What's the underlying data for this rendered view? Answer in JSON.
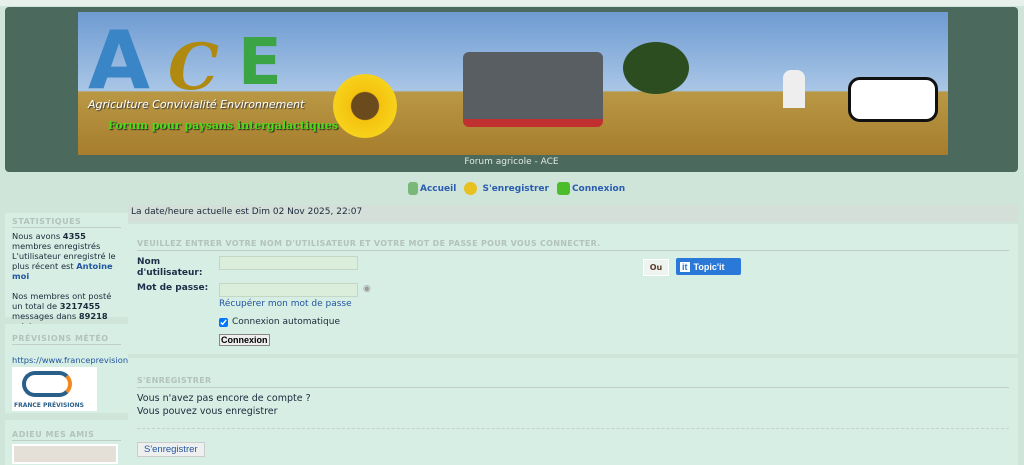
{
  "header": {
    "logo_letters": "ACE",
    "logo_tagline": "Agriculture  Convivialité  Environnement",
    "logo_subtitle": "Forum pour paysans intergalactiques",
    "site_title": "Forum agricole - ACE"
  },
  "nav": [
    {
      "label": "Accueil",
      "icon": "home-icon"
    },
    {
      "label": "S'enregistrer",
      "icon": "smiley-icon"
    },
    {
      "label": "Connexion",
      "icon": "thumbs-up-icon"
    }
  ],
  "sidebar": {
    "stats": {
      "title": "STATISTIQUES",
      "line1a": "Nous avons ",
      "members": "4355",
      "line1b": " membres enregistrés",
      "line2": "L'utilisateur enregistré le plus récent est ",
      "newest": "Antoine moi",
      "line3a": "Nos membres ont posté un total de ",
      "messages": "3217455",
      "line3b": " messages dans ",
      "topics": "89218",
      "line3c": " sujets"
    },
    "meteo": {
      "title": "PRÉVISIONS MÉTÉO",
      "link": "https://www.franceprevisions.",
      "logo_text": "FRANCE PRÉVISIONS"
    },
    "adieu": {
      "title": "ADIEU MES AMIS"
    }
  },
  "main": {
    "datetime": "La date/heure actuelle est Dim 02 Nov 2025, 22:07",
    "login": {
      "title": "VEUILLEZ ENTRER VOTRE NOM D'UTILISATEUR ET VOTRE MOT DE PASSE POUR VOUS CONNECTER.",
      "username_label": "Nom d'utilisateur:",
      "username_value": "",
      "password_label": "Mot de passe:",
      "password_value": "",
      "forgot": "Récupérer mon mot de passe",
      "auto_login": "Connexion automatique",
      "auto_login_checked": true,
      "submit": "Connexion",
      "or": "Ou",
      "topicit": "Topic'it"
    },
    "register": {
      "title": "S'ENREGISTRER",
      "line1": "Vous n'avez pas encore de compte ?",
      "line2": "Vous pouvez vous enregistrer",
      "button": "S'enregistrer"
    }
  },
  "colors": {
    "header_bg": "#4b6a5d",
    "page_bg": "#d7eee4",
    "link": "#2355a0",
    "topicit": "#2a78d8"
  }
}
